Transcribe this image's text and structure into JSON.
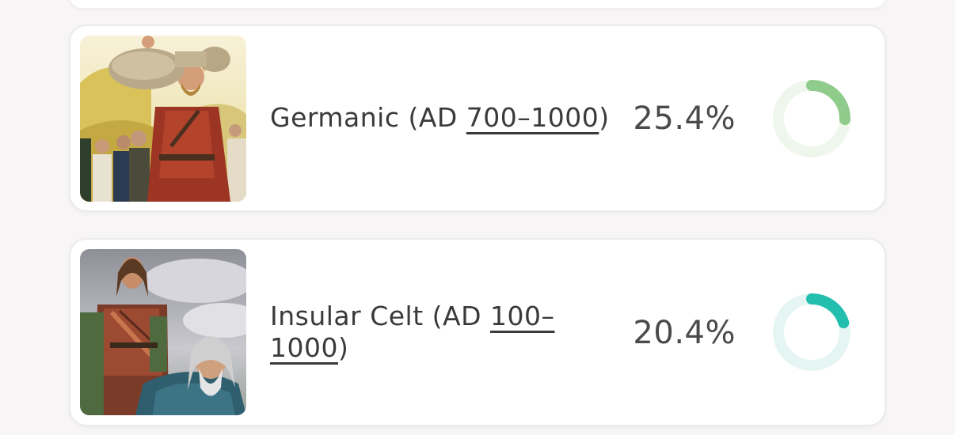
{
  "cards": [
    {
      "title_prefix": "Germanic (AD ",
      "date_range": "700–1000",
      "title_suffix": ")",
      "percent": "25.4%",
      "value": 0.254,
      "ring_color": "#8fcb8a",
      "track_color": "#eff7ed",
      "image": "germanic-traveler-image"
    },
    {
      "title_prefix": "Insular Celt (AD ",
      "date_range": "100–1000",
      "title_suffix": ")",
      "percent": "20.4%",
      "value": 0.204,
      "ring_color": "#23bfae",
      "track_color": "#e4f5f4",
      "image": "insular-celt-image"
    }
  ]
}
